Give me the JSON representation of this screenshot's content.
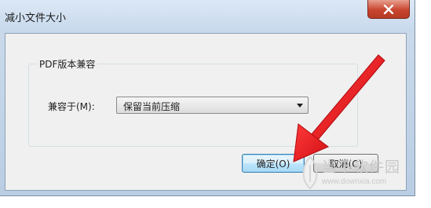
{
  "window": {
    "title": "减小文件大小",
    "close_icon": "close-icon"
  },
  "group": {
    "legend": "PDF版本兼容",
    "compat_label": "兼容于(M):",
    "compat_select": {
      "value": "保留当前压缩",
      "icon": "chevron-down-icon"
    }
  },
  "buttons": {
    "ok_label": "确定(O)",
    "cancel_label": "取消(C)"
  },
  "annotation": {
    "color": "#e8151b",
    "icon": "red-arrow"
  },
  "watermark": {
    "title": "当下软件园",
    "url": "www.downxia.com",
    "icon": "logo-icon"
  },
  "colors": {
    "close_button": "#c9452f",
    "default_button_border": "#3c7fb1"
  }
}
